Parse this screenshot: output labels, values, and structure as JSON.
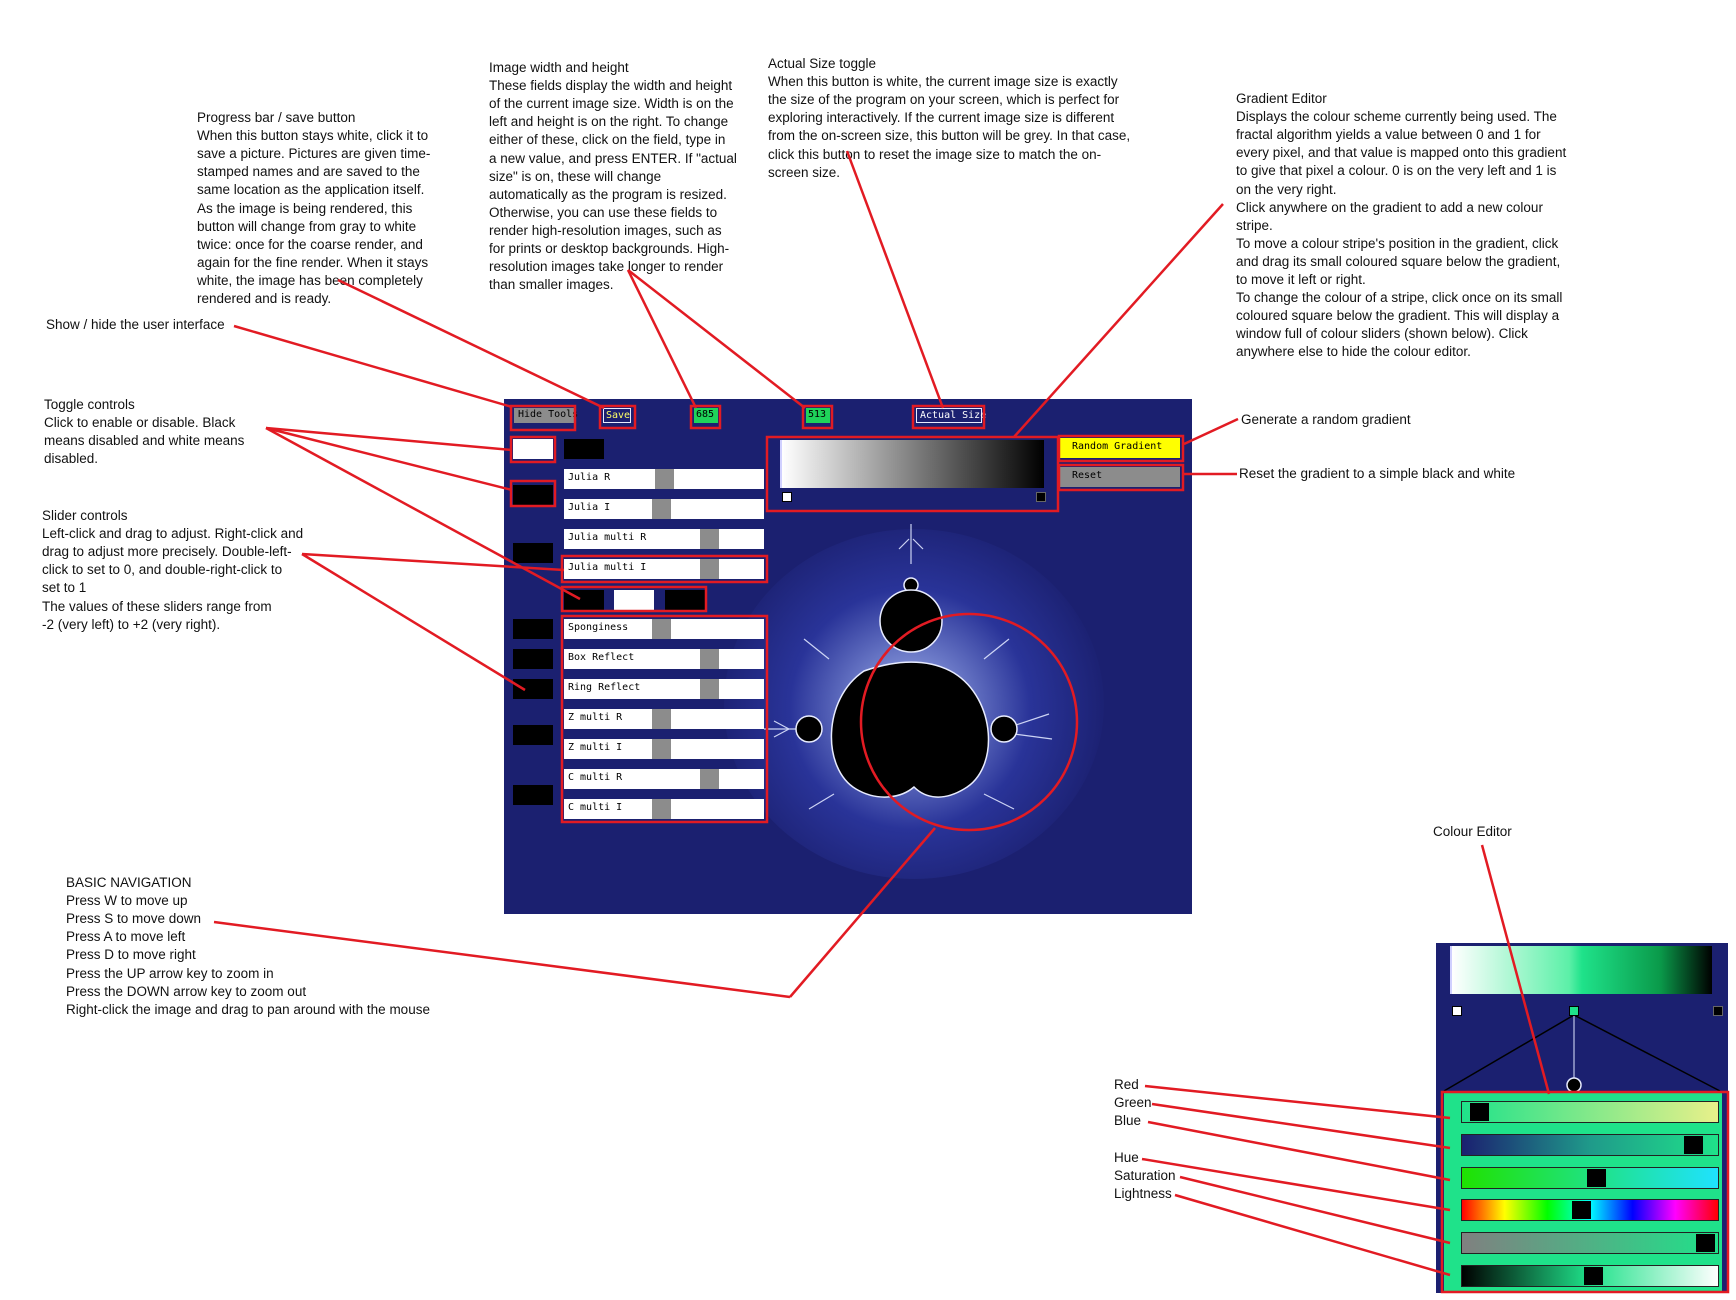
{
  "toolbar": {
    "hide_tools": "Hide Tools",
    "save": "Save",
    "width": "685",
    "height": "513",
    "actual_size": "Actual Size"
  },
  "gradient_buttons": {
    "random": "Random Gradient",
    "reset": "Reset"
  },
  "sliders_top": [
    {
      "label": "Julia R",
      "value": 0.0
    },
    {
      "label": "Julia I",
      "value": -0.06
    },
    {
      "label": "Julia multi R",
      "value": 1.0
    },
    {
      "label": "Julia multi I",
      "value": 1.0
    }
  ],
  "sliders_bottom": [
    {
      "label": "Sponginess",
      "value": -0.06
    },
    {
      "label": "Box Reflect",
      "value": 1.0
    },
    {
      "label": "Ring Reflect",
      "value": 1.0
    },
    {
      "label": "Z multi R",
      "value": -0.06
    },
    {
      "label": "Z multi I",
      "value": -0.06
    },
    {
      "label": "C multi R",
      "value": 1.0
    },
    {
      "label": "C multi I",
      "value": -0.06
    }
  ],
  "notes": {
    "progress_title": "Progress bar / save button",
    "progress_body": "When this button stays white, click it to\nsave a picture. Pictures are given time-\nstamped names and are saved to the\nsame location as the application itself.\nAs the image is being rendered, this\nbutton will change from gray to white\ntwice: once for the coarse render, and\nagain for the fine render. When it stays\nwhite, the image has been completely\nrendered and is ready.",
    "image_size_title": "Image width and height",
    "image_size_body": "These fields display the width and height\nof the current image size. Width is on the\nleft and height is on the right. To change\neither of these, click on the field, type in\na new value, and press ENTER. If \"actual\nsize\" is on, these will change\nautomatically as the program is resized.\nOtherwise, you can use these fields to\nrender high-resolution images, such as\nfor prints or desktop backgrounds. High-\nresolution images take longer to render\nthan smaller images.",
    "actual_size_title": "Actual Size toggle",
    "actual_size_body": "When this button is white, the current image size is exactly\nthe size of the program on your screen, which is perfect for\nexploring interactively. If the current image size is different\nfrom the on-screen size, this button will be grey. In that case,\nclick this button to reset the image size to match the on-\nscreen size.",
    "gradient_title": "Gradient Editor",
    "gradient_body": "Displays the colour scheme currently being used. The\nfractal algorithm yields a value between 0 and 1 for\nevery pixel, and that value is mapped onto this gradient\nto give that pixel a colour. 0 is on the very left and 1 is\non the very right.\nClick anywhere on the gradient to add a new colour\nstripe.\nTo move a colour stripe's position in the gradient, click\nand drag its small coloured square below the gradient,\nto move it left or right.\nTo change the colour of a stripe, click once on its small\ncoloured square below the gradient. This will display a\nwindow full of colour sliders (shown below). Click\nanywhere else to hide the colour editor.",
    "show_hide": "Show / hide the user interface",
    "toggle_title": "Toggle controls",
    "toggle_body": "Click to enable or disable. Black\nmeans disabled and white means\ndisabled.",
    "slider_title": "Slider controls",
    "slider_body": "Left-click and drag to adjust. Right-click and\ndrag to adjust more precisely. Double-left-\nclick to set to 0, and double-right-click to\nset to 1\nThe values of these sliders range from\n-2 (very left) to +2 (very right).",
    "random_gradient": "Generate a random gradient",
    "reset_gradient": "Reset the gradient to a simple black and white",
    "nav_title": "BASIC NAVIGATION",
    "nav_body": "Press W to move up\nPress S to move down\nPress A to move left\nPress D to move right\nPress the UP arrow key to zoom in\nPress the DOWN arrow key to zoom out\nRight-click the image and drag to pan around with the mouse",
    "colour_editor": "Colour Editor",
    "red": "Red",
    "green": "Green",
    "blue": "Blue",
    "hue": "Hue",
    "saturation": "Saturation",
    "lightness": "Lightness"
  },
  "colours": {
    "annotation": "#e21b23",
    "app_bg": "#1b2070",
    "random_btn": "#ffff00",
    "stripe": "#1fe28a"
  }
}
